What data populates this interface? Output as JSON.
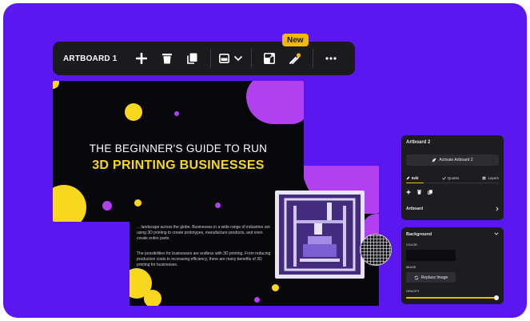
{
  "colors": {
    "background": "#5b17f0",
    "toolbar": "#1b1b1d",
    "accent_yellow": "#f5b800",
    "slide_yellow": "#f7d81e",
    "blob_purple": "#b040f0",
    "panel": "#1d1d20"
  },
  "toolbar": {
    "title": "ARTBOARD 1",
    "new_badge": "New",
    "icons": [
      "plus-icon",
      "trash-icon",
      "duplicate-icon",
      "layout-icon",
      "chevron-down-icon",
      "resize-icon",
      "magic-wand-icon",
      "more-icon"
    ]
  },
  "slide": {
    "title_line1": "THE BEGINNER'S GUIDE TO RUN",
    "title_line2": "3D PRINTING BUSINESSES"
  },
  "slide2": {
    "para1": "... landscape across the globe. Businesses in a wide range of industries are using 3D printing to create prototypes, manufacture products, and even create entire parts.",
    "para2": "The possibilities for businesses are endless with 3D printing. From reducing production costs to increasing efficiency, there are many benefits of 3D printing for businesses."
  },
  "panel_artboard": {
    "title": "Artboard 2",
    "activate_button": "Activate Artboard 2",
    "tabs": [
      {
        "label": "Edit",
        "icon": "edit-icon"
      },
      {
        "label": "Quotes",
        "icon": "check-icon"
      },
      {
        "label": "Layers",
        "icon": "layers-icon"
      }
    ],
    "section": "Artboard"
  },
  "panel_background": {
    "title": "Background",
    "color_label": "COLOR",
    "image_label": "IMAGE",
    "replace_button": "Replace Image",
    "opacity_label": "OPACITY",
    "opacity_value": 1.0
  }
}
